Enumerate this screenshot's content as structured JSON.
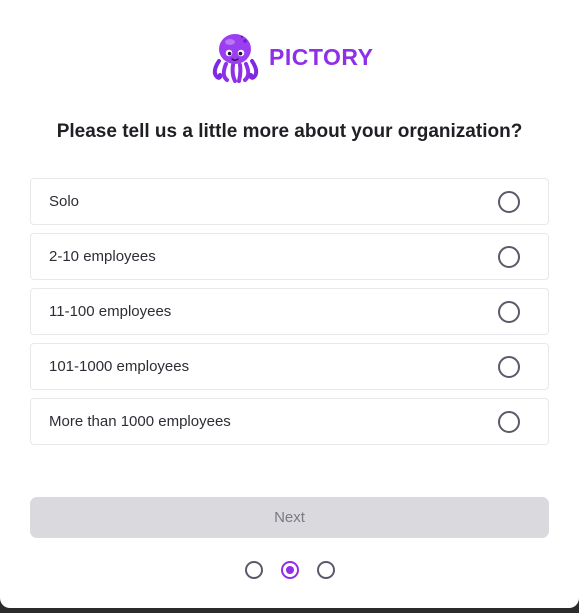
{
  "brand": {
    "name": "PICTORY",
    "color": "#8f2fe8",
    "logo_icon": "octopus-icon"
  },
  "question": "Please tell us a little more about your organization?",
  "options": [
    {
      "label": "Solo",
      "selected": false
    },
    {
      "label": "2-10 employees",
      "selected": false
    },
    {
      "label": "11-100 employees",
      "selected": false
    },
    {
      "label": "101-1000 employees",
      "selected": false
    },
    {
      "label": "More than 1000 employees",
      "selected": false
    }
  ],
  "next_button": {
    "label": "Next",
    "enabled": false
  },
  "stepper": {
    "total": 3,
    "current": 2
  }
}
